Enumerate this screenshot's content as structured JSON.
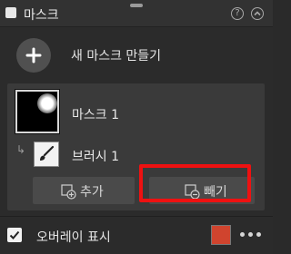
{
  "header": {
    "title": "마스크"
  },
  "new_mask": {
    "label": "새 마스크 만들기"
  },
  "mask": {
    "name": "마스크 1",
    "brush_name": "브러시 1"
  },
  "buttons": {
    "add_label": "추가",
    "subtract_label": "빼기"
  },
  "overlay": {
    "label": "오버레이 표시",
    "checked": true,
    "color": "#d0442e"
  },
  "icons": {
    "help": "?",
    "collapse": "chevron-up-icon",
    "new_mask": "plus-icon",
    "brush": "brush-icon",
    "add": "add-mask-icon",
    "subtract": "subtract-mask-icon",
    "more": "more-icon"
  },
  "highlight_color": "#ee1111"
}
